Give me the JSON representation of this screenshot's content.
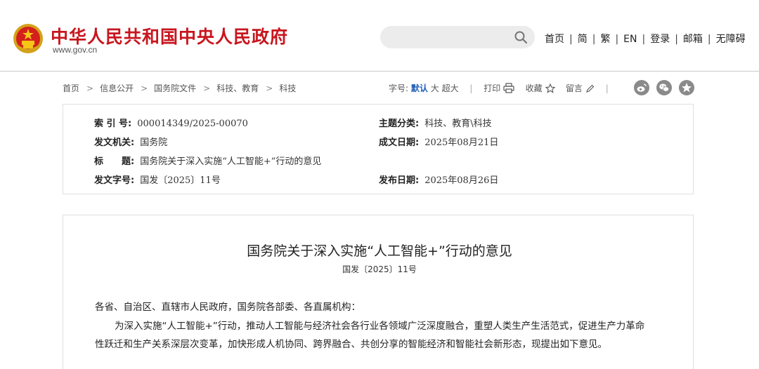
{
  "header": {
    "site_title": "中华人民共和国中央人民政府",
    "site_domain": "www.gov.cn",
    "search_placeholder": "",
    "nav": [
      "首页",
      "简",
      "繁",
      "EN",
      "登录",
      "邮箱",
      "无障碍"
    ],
    "colors": {
      "brand": "#c8161e",
      "accent": "#1f5fb5"
    }
  },
  "breadcrumb": [
    "首页",
    "信息公开",
    "国务院文件",
    "科技、教育",
    "科技"
  ],
  "tools": {
    "font_size_label": "字号:",
    "font_default": "默认",
    "font_large": "大",
    "font_xlarge": "超大",
    "print": "打印",
    "favorite": "收藏",
    "comment": "留言",
    "share_icons": [
      "weibo-icon",
      "wechat-icon",
      "qzone-icon"
    ]
  },
  "meta": {
    "index_label": "索 引 号:",
    "index_value": "000014349/2025-00070",
    "topic_label": "主题分类:",
    "topic_value": "科技、教育\\科技",
    "issuer_label": "发文机关:",
    "issuer_value": "国务院",
    "written_label": "成文日期:",
    "written_value": "2025年08月21日",
    "title_label": "标　　题:",
    "title_value": "国务院关于深入实施“人工智能+”行动的意见",
    "docnum_label": "发文字号:",
    "docnum_value": "国发〔2025〕11号",
    "publish_label": "发布日期:",
    "publish_value": "2025年08月26日"
  },
  "document": {
    "title": "国务院关于深入实施“人工智能+”行动的意见",
    "number": "国发〔2025〕11号",
    "salutation": "各省、自治区、直辖市人民政府，国务院各部委、各直属机构：",
    "para1_line1": "为深入实施“人工智能+”行动，推动人工智能与经济社会各行业各领域广泛深度融合，重塑人类生产生活范式，促进生产力革命",
    "para1_line2": "性跃迁和生产关系深层次变革，加快形成人机协同、跨界融合、共创分享的智能经济和智能社会新形态，现提出如下意见。"
  }
}
